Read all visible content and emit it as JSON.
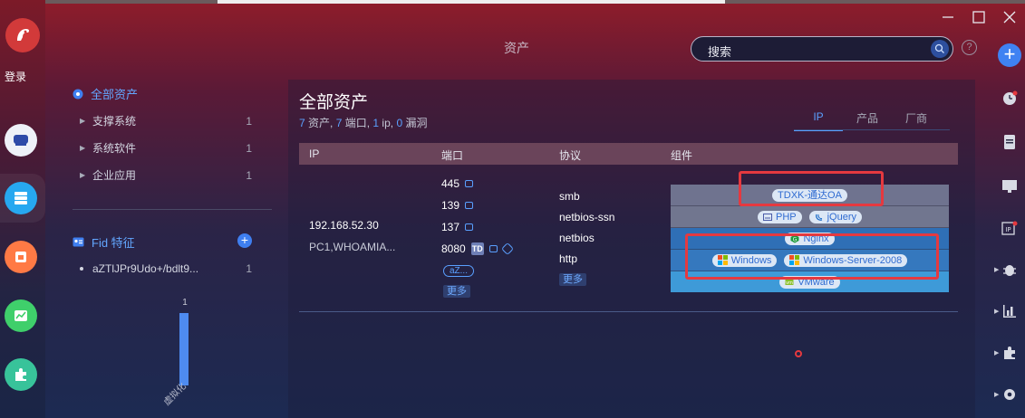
{
  "app": {
    "login_label": "登录",
    "page_title": "资产",
    "search_placeholder": "搜索",
    "help_label": "?"
  },
  "left_nav": {
    "root_label": "全部资产",
    "items": [
      {
        "label": "支撑系统",
        "count": "1"
      },
      {
        "label": "系统软件",
        "count": "1"
      },
      {
        "label": "企业应用",
        "count": "1"
      }
    ],
    "fid_label": "Fid 特征",
    "fid_item": {
      "label": "aZTlJPr9Udo+/bdlt9...",
      "count": "1"
    },
    "chart_data": {
      "type": "bar",
      "categories": [
        "虚拟化"
      ],
      "values": [
        1
      ],
      "title": "",
      "xlabel": "",
      "ylabel": ""
    }
  },
  "main": {
    "title": "全部资产",
    "stats": {
      "assets": "7",
      "assets_label": " 资产, ",
      "ports": "7",
      "ports_label": " 端口, ",
      "ips": "1",
      "ips_label": " ip, ",
      "vulns": "0",
      "vulns_label": " 漏洞"
    },
    "tabs": [
      "IP",
      "产品",
      "厂商"
    ],
    "active_tab": "IP",
    "columns": [
      "IP",
      "端口",
      "协议",
      "组件"
    ],
    "row": {
      "ip": "192.168.52.30",
      "host": "PC1,WHOAMIA...",
      "ports": [
        "445",
        "139",
        "137",
        "8080"
      ],
      "port_extra": "aZ...",
      "port_more": "更多",
      "protocols": [
        "smb",
        "netbios-ssn",
        "netbios",
        "http"
      ],
      "proto_more": "更多",
      "components": [
        [
          "TDXK-通达OA"
        ],
        [
          "PHP",
          "jQuery"
        ],
        [
          "Nginx"
        ],
        [
          "Windows",
          "Windows-Server-2008"
        ],
        [
          "VMware"
        ]
      ],
      "td_badge": "TD"
    }
  },
  "colors": {
    "accent": "#5aa0ff",
    "highlight": "#e5393f",
    "comp_row_dark": "#6f738f",
    "comp_row_blue": "#2f6fb6",
    "comp_row_light": "#3e9ad8"
  }
}
